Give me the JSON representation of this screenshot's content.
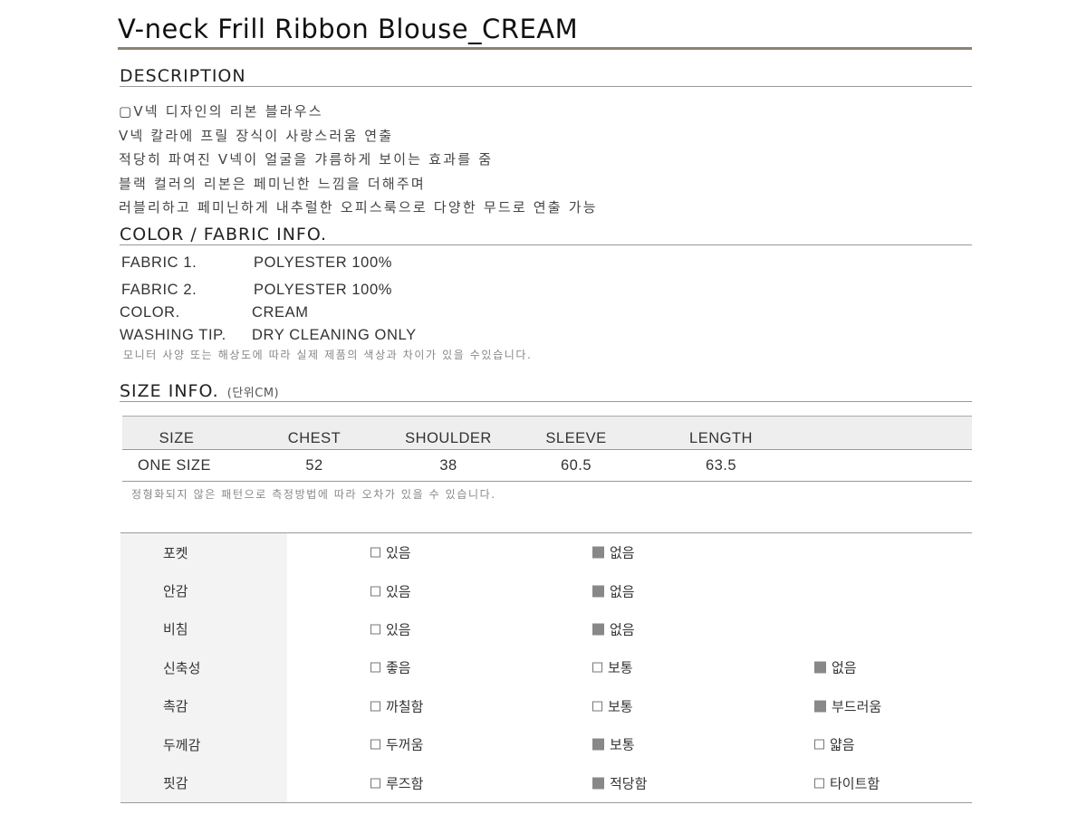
{
  "title": "V-neck Frill Ribbon Blouse_CREAM",
  "description": {
    "heading": "DESCRIPTION",
    "lines": [
      "▢V넥 디자인의 리본 블라우스",
      "V넥 칼라에 프릴 장식이 사랑스러움 연출",
      "적당히 파여진 V넥이 얼굴을 갸름하게 보이는 효과를 줌",
      "블랙 컬러의 리본은 페미닌한 느낌을 더해주며",
      "러블리하고 페미닌하게 내추럴한 오피스룩으로 다양한 무드로 연출 가능"
    ]
  },
  "fabric": {
    "heading": "COLOR / FABRIC INFO.",
    "rows": [
      {
        "key": "FABRIC 1.",
        "value": "POLYESTER 100%"
      },
      {
        "key": "FABRIC 2.",
        "value": "POLYESTER 100%"
      },
      {
        "key": "COLOR.",
        "value": "CREAM"
      },
      {
        "key": "WASHING TIP.",
        "value": "DRY CLEANING ONLY"
      }
    ],
    "note": "모니터 사양 또는 해상도에 따라 실제 제품의 색상과 차이가 있을 수있습니다."
  },
  "size": {
    "heading": "SIZE INFO.",
    "unit": "(단위CM)",
    "columns": [
      "SIZE",
      "CHEST",
      "SHOULDER",
      "SLEEVE",
      "LENGTH",
      ""
    ],
    "rows": [
      [
        "ONE SIZE",
        "52",
        "38",
        "60.5",
        "63.5",
        ""
      ]
    ],
    "note": "정형화되지 않은 패턴으로 측정방법에 따라 오차가 있을 수 있습니다."
  },
  "attributes": [
    {
      "label": "포켓",
      "options": [
        {
          "text": "있음",
          "checked": false
        },
        {
          "text": "없음",
          "checked": true
        }
      ]
    },
    {
      "label": "안감",
      "options": [
        {
          "text": "있음",
          "checked": false
        },
        {
          "text": "없음",
          "checked": true
        }
      ]
    },
    {
      "label": "비침",
      "options": [
        {
          "text": "있음",
          "checked": false
        },
        {
          "text": "없음",
          "checked": true
        }
      ]
    },
    {
      "label": "신축성",
      "options": [
        {
          "text": "좋음",
          "checked": false
        },
        {
          "text": "보통",
          "checked": false
        },
        {
          "text": "없음",
          "checked": true
        }
      ]
    },
    {
      "label": "촉감",
      "options": [
        {
          "text": "까칠함",
          "checked": false
        },
        {
          "text": "보통",
          "checked": false
        },
        {
          "text": "부드러움",
          "checked": true
        }
      ]
    },
    {
      "label": "두께감",
      "options": [
        {
          "text": "두꺼움",
          "checked": false
        },
        {
          "text": "보통",
          "checked": true
        },
        {
          "text": "얇음",
          "checked": false
        }
      ]
    },
    {
      "label": "핏감",
      "options": [
        {
          "text": "루즈함",
          "checked": false
        },
        {
          "text": "적당함",
          "checked": true
        },
        {
          "text": "타이트함",
          "checked": false
        }
      ]
    }
  ],
  "colors": {
    "title_rule": "#8b8374",
    "checked_box": "#888888",
    "label_bg": "#f3f3f3",
    "header_bg": "#eeeeee"
  }
}
